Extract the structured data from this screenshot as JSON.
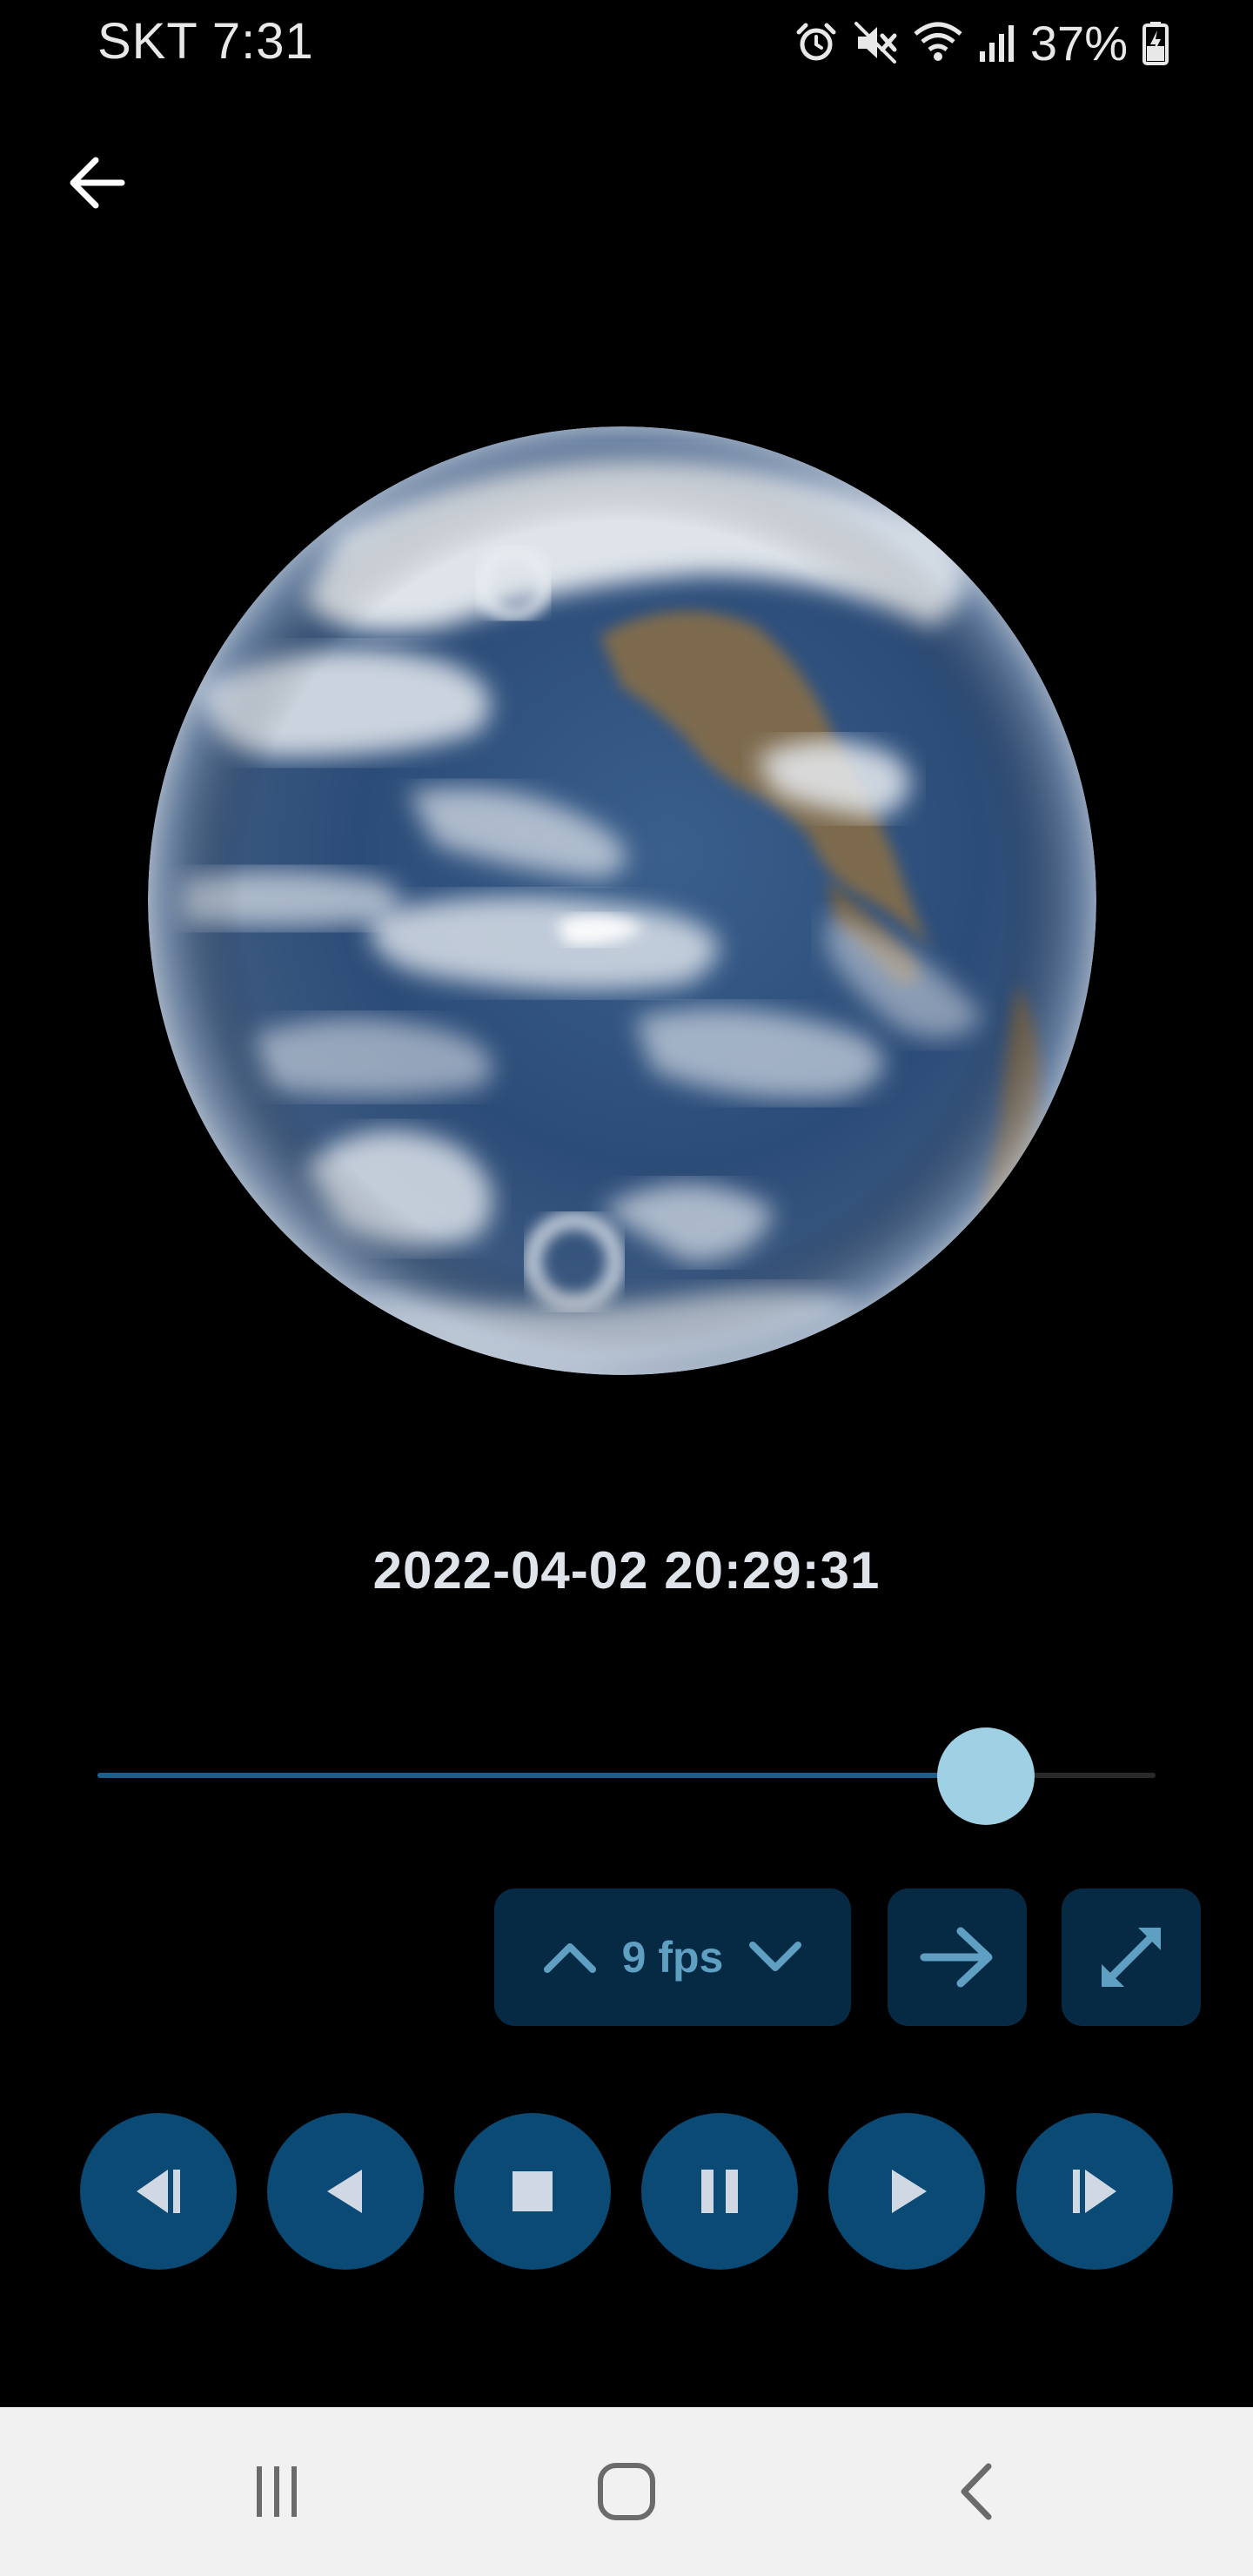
{
  "status_bar": {
    "carrier_time": "SKT 7:31",
    "battery": "37%",
    "icons": [
      "alarm-icon",
      "mute-icon",
      "wifi-icon",
      "signal-icon",
      "battery-icon"
    ]
  },
  "header": {
    "back_icon": "arrow-left-icon"
  },
  "image": {
    "subject": "earth-globe"
  },
  "timestamp": "2022-04-02 20:29:31",
  "slider": {
    "progress": 0.84
  },
  "controls": {
    "fps_label": "9 fps",
    "fps_up_icon": "chevron-up-icon",
    "fps_down_icon": "chevron-down-icon",
    "next_icon": "arrow-right-icon",
    "fullscreen_icon": "expand-icon"
  },
  "playback": [
    {
      "name": "skip-to-start-button",
      "icon": "skip-previous-icon"
    },
    {
      "name": "step-back-button",
      "icon": "play-reverse-icon"
    },
    {
      "name": "stop-button",
      "icon": "stop-icon"
    },
    {
      "name": "pause-button",
      "icon": "pause-icon"
    },
    {
      "name": "play-button",
      "icon": "play-icon"
    },
    {
      "name": "skip-to-end-button",
      "icon": "skip-next-icon"
    }
  ],
  "nav_bar": {
    "icons": [
      "recent-apps-icon",
      "home-icon",
      "back-icon"
    ]
  },
  "colors": {
    "background": "#000000",
    "control_bg": "#072a44",
    "playback_bg": "#0a4a75",
    "accent": "#9fd0e4",
    "fill": "#1d5f8c",
    "fps_text": "#5f9fc2",
    "nav_bg": "#f1f1f1"
  }
}
